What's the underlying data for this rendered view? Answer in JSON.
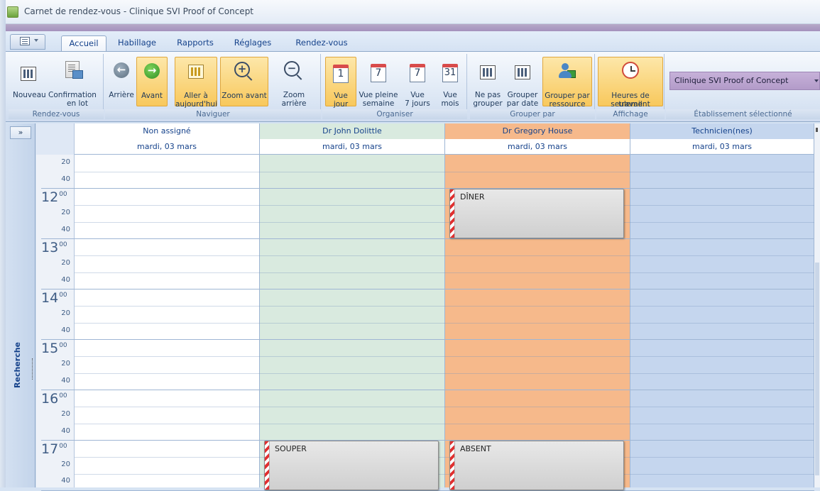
{
  "window": {
    "title": "Carnet de rendez-vous  - Clinique SVI Proof of Concept"
  },
  "tabs": [
    {
      "label": "Accueil",
      "active": true
    },
    {
      "label": "Habillage"
    },
    {
      "label": "Rapports"
    },
    {
      "label": "Réglages"
    },
    {
      "label": "Rendez-vous"
    }
  ],
  "ribbon": {
    "groups": {
      "rendezvous": {
        "label": "Rendez-vous",
        "buttons": [
          {
            "label": "Nouveau",
            "icon": "calendar-grid-icon"
          },
          {
            "label": "Confirmation\nen lot",
            "line1": "Confirmation",
            "line2": "en lot",
            "icon": "batch-confirm-icon"
          }
        ]
      },
      "naviguer": {
        "label": "Naviguer",
        "buttons": [
          {
            "label": "Arrière",
            "icon": "back-arrow-icon"
          },
          {
            "label": "Avant",
            "icon": "forward-arrow-icon",
            "active": true
          },
          {
            "line1": "Aller à",
            "line2": "aujourd'hui",
            "icon": "today-icon",
            "active": true
          },
          {
            "label": "Zoom avant",
            "icon": "zoom-in-icon",
            "active": true
          },
          {
            "label": "Zoom arrière",
            "icon": "zoom-out-icon"
          }
        ]
      },
      "organiser": {
        "label": "Organiser",
        "buttons": [
          {
            "line1": "Vue",
            "line2": "jour",
            "icon": "calendar-day-icon",
            "num": "1",
            "active": true
          },
          {
            "line1": "Vue pleine",
            "line2": "semaine",
            "icon": "calendar-week-icon",
            "num": "7"
          },
          {
            "line1": "Vue",
            "line2": "7 jours",
            "icon": "calendar-7days-icon",
            "num": "7"
          },
          {
            "line1": "Vue",
            "line2": "mois",
            "icon": "calendar-month-icon",
            "num": "31"
          }
        ]
      },
      "grouper": {
        "label": "Grouper par",
        "buttons": [
          {
            "line1": "Ne pas",
            "line2": "grouper",
            "icon": "no-group-icon"
          },
          {
            "line1": "Grouper",
            "line2": "par date",
            "icon": "group-date-icon"
          },
          {
            "line1": "Grouper par",
            "line2": "ressource",
            "icon": "group-resource-icon",
            "active": true
          }
        ]
      },
      "affichage": {
        "label": "Affichage",
        "buttons": [
          {
            "line1": "Heures de travail",
            "line2": "seulement",
            "icon": "work-hours-icon",
            "active": true
          }
        ]
      },
      "etablissement": {
        "label": "Établissement sélectionné",
        "selected": "Clinique SVI Proof of Concept"
      }
    }
  },
  "sidepanel": {
    "expand": "»",
    "search": "Recherche"
  },
  "scheduler": {
    "columns": [
      {
        "name": "Non assigné",
        "date": "mardi, 03 mars",
        "color": "#ffffff"
      },
      {
        "name": "Dr John Dolittle",
        "date": "mardi, 03 mars",
        "color": "#d9eadf"
      },
      {
        "name": "Dr Gregory House",
        "date": "mardi, 03 mars",
        "color": "#f6b98b"
      },
      {
        "name": "Technicien(nes)",
        "date": "mardi, 03 mars",
        "color": "#c5d6ee"
      }
    ],
    "time": {
      "minute_labels": [
        "20",
        "40",
        "20",
        "40",
        "20",
        "40",
        "20",
        "40",
        "20",
        "40",
        "20",
        "40",
        "20",
        "40"
      ],
      "hours": [
        "12",
        "13",
        "14",
        "15",
        "16",
        "17"
      ],
      "hour_suffix": "00"
    },
    "appointments": [
      {
        "column": "Dr Gregory House",
        "title": "DÎNER"
      },
      {
        "column": "Dr John Dolittle",
        "title": "SOUPER"
      },
      {
        "column": "Dr Gregory House",
        "title": "ABSENT"
      }
    ]
  }
}
